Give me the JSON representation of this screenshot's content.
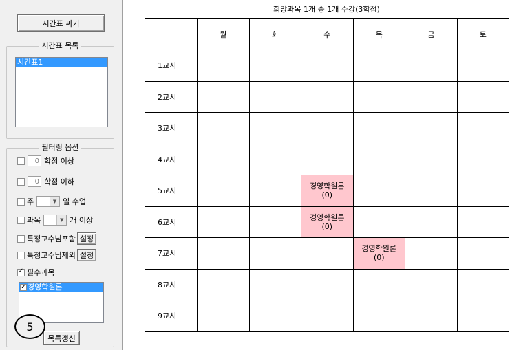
{
  "left_panel": {
    "make_timetable_button": "시간표 짜기",
    "timetable_list": {
      "title": "시간표 목록",
      "items": [
        "시간표1"
      ],
      "selected_index": 0
    },
    "filter_options": {
      "title": "필터링 옵션",
      "min_credits": {
        "value": "0",
        "label": "학점 이상",
        "checked": false
      },
      "max_credits": {
        "value": "0",
        "label": "학점 이하",
        "checked": false
      },
      "days_per_week": {
        "prefix": "주",
        "suffix": "일 수업",
        "checked": false
      },
      "course_count": {
        "prefix": "과목",
        "suffix": "개 이상",
        "checked": false
      },
      "include_professor": {
        "label": "특정교수님포함",
        "button": "설정",
        "checked": false
      },
      "exclude_professor": {
        "label": "특정교수님제외",
        "button": "설정",
        "checked": false
      },
      "required_courses": {
        "label": "필수과목",
        "checked": true
      }
    },
    "required_course_list": [
      {
        "name": "경영학원론",
        "checked": true
      }
    ],
    "refresh_button": "목록갱신",
    "step_badge": "5"
  },
  "timetable": {
    "title": "희망과목 1개 중 1개 수강(3학점)",
    "days": [
      "월",
      "화",
      "수",
      "목",
      "금",
      "토"
    ],
    "periods": [
      "1교시",
      "2교시",
      "3교시",
      "4교시",
      "5교시",
      "6교시",
      "7교시",
      "8교시",
      "9교시"
    ],
    "entries": [
      {
        "period": 4,
        "day": 2,
        "course": "경영학원론",
        "note": "(0)"
      },
      {
        "period": 5,
        "day": 2,
        "course": "경영학원론",
        "note": "(0)"
      },
      {
        "period": 6,
        "day": 3,
        "course": "경영학원론",
        "note": "(0)"
      }
    ]
  },
  "colors": {
    "panel_bg": "#f0f0f0",
    "selection": "#3399ff",
    "course_cell": "#ffc7ce"
  }
}
